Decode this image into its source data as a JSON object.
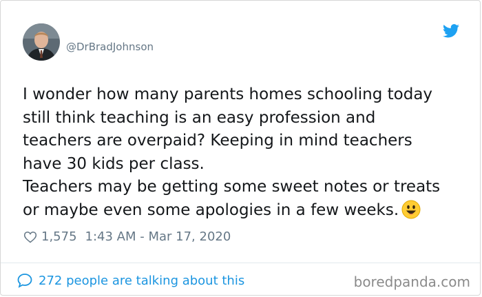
{
  "tweet": {
    "handle": "@DrBradJohnson",
    "text_lines": [
      "I wonder how many parents homes schooling today",
      "still think teaching is an easy profession and",
      "teachers are overpaid? Keeping in mind teachers",
      "have 30 kids per class.",
      "Teachers may be getting some sweet notes or treats",
      "or maybe even some apologies in a few weeks."
    ],
    "likes": "1,575",
    "timestamp": "1:43 AM - Mar 17, 2020"
  },
  "footer": {
    "discussion_link": "272 people are talking about this",
    "brand": "boredpanda.com"
  },
  "icons": {
    "bird": "twitter-bird-icon",
    "heart": "heart-icon",
    "bubble": "speech-bubble-icon",
    "emoji": "smiley-emoji-icon"
  },
  "colors": {
    "twitter_blue": "#1da1f2",
    "link_blue": "#1b95e0",
    "muted": "#657786",
    "text": "#14171a"
  }
}
